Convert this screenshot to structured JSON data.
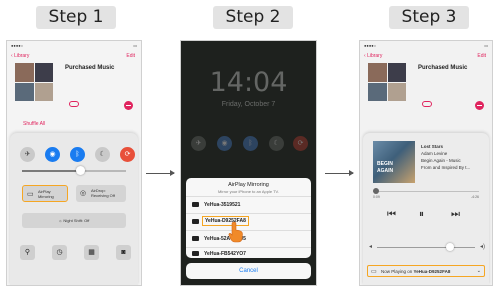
{
  "steps": {
    "step1": "Step 1",
    "step2": "Step 2",
    "step3": "Step 3"
  },
  "music": {
    "back_label": "Library",
    "edit_label": "Edit",
    "album_title": "Purchased Music",
    "shuffle_label": "Shuffle All"
  },
  "control_center": {
    "airplay_label": "AirPlay Mirroring",
    "airdrop_label": "AirDrop: Receiving Off",
    "night_shift_label": "Night Shift: Off"
  },
  "lock_screen": {
    "time": "14:04",
    "date": "Friday, October 7"
  },
  "airplay_sheet": {
    "title": "AirPlay Mirroring",
    "subtitle": "Mirror your iPhone to an Apple TV.",
    "devices": [
      "YeHua-3519521",
      "YeHua-D9252FA8",
      "YeHua-52AC2GJ5",
      "YeHua-FB542YO7"
    ],
    "selected_index": 1,
    "cancel_label": "Cancel"
  },
  "now_playing": {
    "track": "Lost Stars",
    "artist": "Adam Levine",
    "album_line1": "Begin Again - Music",
    "album_line2": "From and Inspired By t...",
    "art_line1": "BEGIN",
    "art_line2": "AGAIN",
    "elapsed": "0:09",
    "remaining": "-4:26",
    "bar_prefix": "Now Playing on",
    "bar_device": "YeHua-D9252FA8"
  },
  "colors": {
    "accent_highlight": "#f5a623",
    "ios_pink": "#e0245e",
    "ios_blue": "#1a7cf0"
  }
}
